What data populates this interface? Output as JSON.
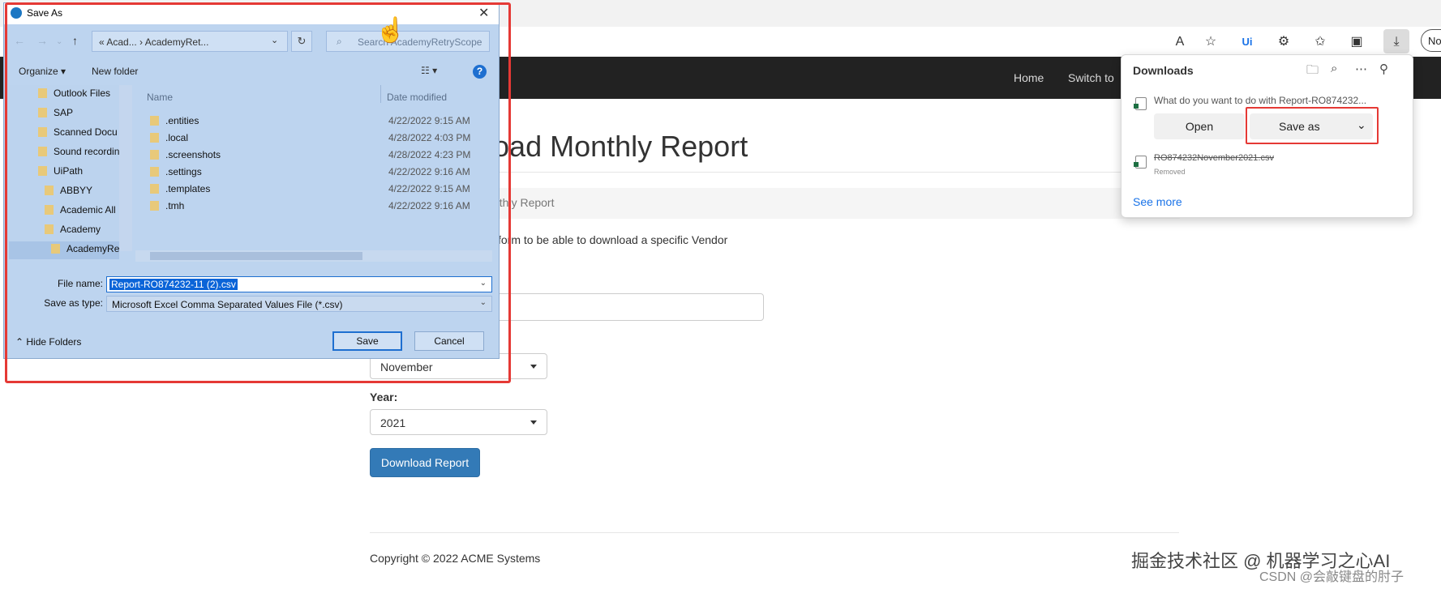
{
  "browser": {
    "toolbar_icons": [
      "read-aloud-icon",
      "favorite-add-icon",
      "uipath-extension-icon",
      "extensions-icon",
      "favorites-icon",
      "collections-icon",
      "downloads-icon"
    ],
    "profile_label": "No"
  },
  "navbar": {
    "links": [
      "Home",
      "Switch to"
    ]
  },
  "page": {
    "title": "nload Monthly Report",
    "breadcrumb": "nthly Report",
    "form_description": "form to be able to download a specific Vendor",
    "month_value": "November",
    "year_label": "Year:",
    "year_value": "2021",
    "download_button": "Download Report",
    "copyright": "Copyright © 2022 ACME Systems"
  },
  "downloads": {
    "title": "Downloads",
    "question": "What do you want to do with Report-RO874232...",
    "open_label": "Open",
    "save_as_label": "Save as",
    "removed_file": "RO874232November2021.csv",
    "removed_status": "Removed",
    "see_more": "See more"
  },
  "dialog": {
    "title": "Save As",
    "address": "« Acad... › AcademyRet...",
    "search_placeholder": "Search AcademyRetryScope",
    "organize": "Organize ▾",
    "new_folder": "New folder",
    "tree": [
      "Outlook Files",
      "SAP",
      "Scanned Docu",
      "Sound recordin",
      "UiPath",
      "ABBYY",
      "Academic All",
      "Academy",
      "AcademyRe"
    ],
    "columns": {
      "name": "Name",
      "date": "Date modified"
    },
    "files": [
      {
        "name": ".entities",
        "date": "4/22/2022 9:15 AM"
      },
      {
        "name": ".local",
        "date": "4/28/2022 4:03 PM"
      },
      {
        "name": ".screenshots",
        "date": "4/28/2022 4:23 PM"
      },
      {
        "name": ".settings",
        "date": "4/22/2022 9:16 AM"
      },
      {
        "name": ".templates",
        "date": "4/22/2022 9:15 AM"
      },
      {
        "name": ".tmh",
        "date": "4/22/2022 9:16 AM"
      }
    ],
    "file_name_label": "File name:",
    "file_name_value": "Report-RO874232-11 (2).csv",
    "save_type_label": "Save as type:",
    "save_type_value": "Microsoft Excel Comma Separated Values File (*.csv)",
    "save_button": "Save",
    "cancel_button": "Cancel",
    "hide_folders": "Hide Folders"
  },
  "watermark": {
    "line1": "掘金技术社区 @ 机器学习之心AI",
    "line2": "CSDN @会敲键盘的肘子"
  },
  "colors": {
    "primary_button": "#337ab7",
    "highlight": "#e53935",
    "navbar": "#222222",
    "link": "#1a73e8"
  }
}
